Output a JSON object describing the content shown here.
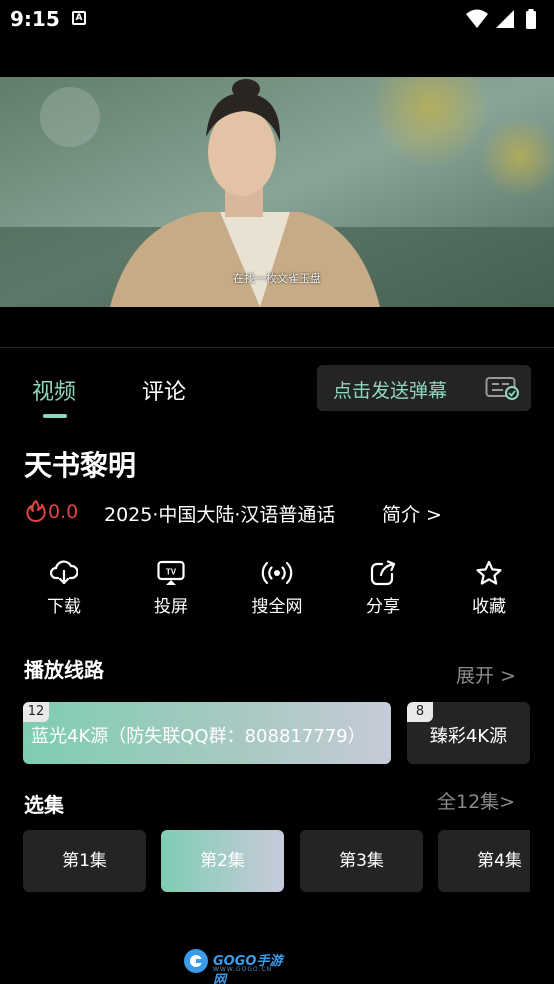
{
  "status_bar": {
    "time": "9:15",
    "notification_icon": "A"
  },
  "video": {
    "subtitle": "在找一枚文雀玉盘"
  },
  "tabs": [
    {
      "label": "视频",
      "active": true
    },
    {
      "label": "评论",
      "active": false
    }
  ],
  "danmaku": {
    "label": "点击发送弹幕"
  },
  "show": {
    "title": "天书黎明",
    "score": "0.0",
    "meta": "2025·中国大陆·汉语普通话",
    "intro_link": "简介 >"
  },
  "actions": [
    {
      "label": "下载",
      "icon": "download-icon"
    },
    {
      "label": "投屏",
      "icon": "tv-cast-icon"
    },
    {
      "label": "搜全网",
      "icon": "broadcast-icon"
    },
    {
      "label": "分享",
      "icon": "share-icon"
    },
    {
      "label": "收藏",
      "icon": "star-icon"
    }
  ],
  "sources": {
    "title": "播放线路",
    "expand": "展开 >",
    "items": [
      {
        "badge": "12",
        "name": "蓝光4K源（防失联QQ群：808817779）",
        "selected": true
      },
      {
        "badge": "8",
        "name": "臻彩4K源",
        "selected": false
      }
    ]
  },
  "episodes": {
    "title": "选集",
    "all": "全12集>",
    "items": [
      {
        "label": "第1集",
        "selected": false
      },
      {
        "label": "第2集",
        "selected": true
      },
      {
        "label": "第3集",
        "selected": false
      },
      {
        "label": "第4集",
        "selected": false
      }
    ]
  },
  "watermark": {
    "brand": "GOGO手游网",
    "url": "WWW.GOGO.CN"
  },
  "colors": {
    "accent": "#8ed7bd",
    "heat": "#e24343",
    "panel": "#242424",
    "background": "#000000"
  }
}
